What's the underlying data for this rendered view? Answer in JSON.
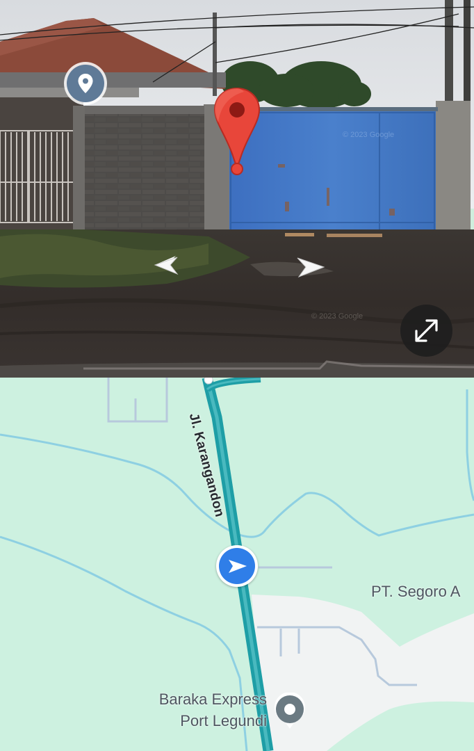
{
  "street_view": {
    "watermark_1": "© 2023 Google",
    "watermark_2": "© 2023 Google",
    "controls": {
      "location_pin_icon": "location-pin-icon",
      "prev_arrow_icon": "chevron-left-icon",
      "next_arrow_icon": "chevron-right-icon",
      "expand_icon": "expand-icon",
      "marker_icon": "red-map-marker-icon"
    }
  },
  "map": {
    "road_label": "Jl. Karangandon",
    "places": [
      {
        "label": "PT. Segoro A"
      },
      {
        "label_line1": "Baraka Express",
        "label_line2": "Port Legundi"
      }
    ],
    "colors": {
      "land": "#cdf1e0",
      "road": "#1e9ea6",
      "water_line": "#8ed0e2",
      "navigation_blue": "#2f7ee8"
    }
  }
}
